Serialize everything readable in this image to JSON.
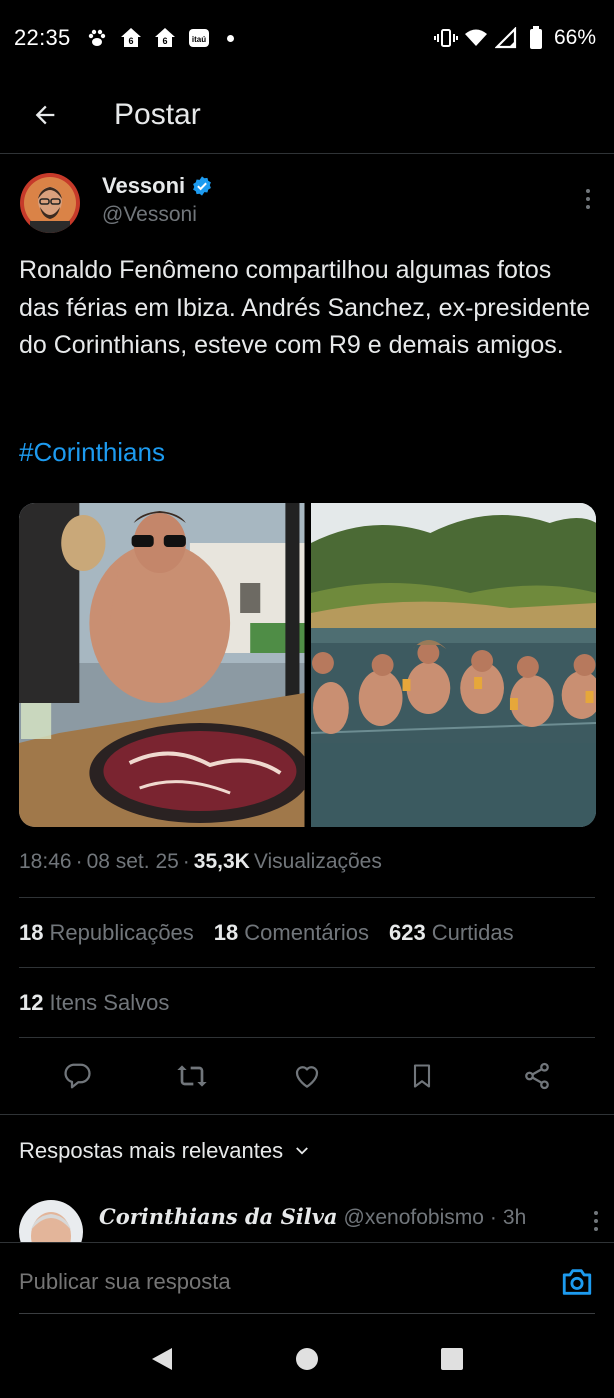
{
  "status_bar": {
    "time": "22:35",
    "battery": "66%",
    "left_icons": [
      "paw-icon",
      "home-6-icon",
      "home-6-icon",
      "itau-icon"
    ],
    "right_icons": [
      "vibrate-icon",
      "wifi-icon",
      "signal-icon",
      "battery-icon"
    ]
  },
  "header": {
    "title": "Postar"
  },
  "tweet": {
    "author_name": "Vessoni",
    "author_handle": "@Vessoni",
    "verified": true,
    "text": "Ronaldo Fenômeno compartilhou algumas fotos das férias em Ibiza. Andrés Sanchez, ex-presidente do Corinthians, esteve com R9 e demais amigos.",
    "hashtag": "#Corinthians",
    "time": "18:46",
    "date": "08 set. 25",
    "views_count": "35,3K",
    "views_label": "Visualizações",
    "reposts_count": "18",
    "reposts_label": "Republicações",
    "comments_count": "18",
    "comments_label": "Comentários",
    "likes_count": "623",
    "likes_label": "Curtidas",
    "saved_count": "12",
    "saved_label": "Itens Salvos"
  },
  "replies": {
    "sort_label": "Respostas mais relevantes",
    "first_reply": {
      "name": "Corinthians da Silva",
      "handle": "@xenofobismo",
      "time": "3h"
    }
  },
  "composer": {
    "placeholder": "Publicar sua resposta"
  },
  "colors": {
    "accent": "#1d9bf0",
    "text": "#e7e9ea",
    "muted": "#71767b",
    "divider": "#2f3336",
    "background": "#000000"
  }
}
